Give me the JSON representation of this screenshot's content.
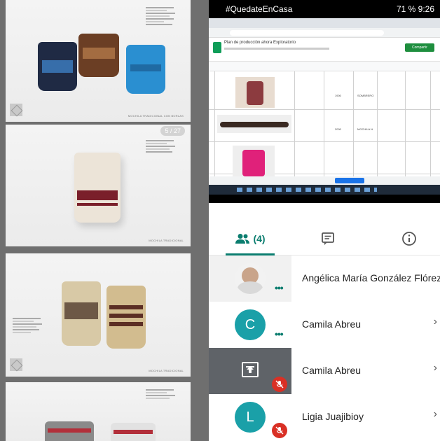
{
  "slides": {
    "pager": "5 / 27",
    "captions": [
      "MOCHILA TRADICIONAL CON BORLAS",
      "MOCHILA TRADICIONAL",
      "MOCHILA TRADICIONAL"
    ]
  },
  "status_bar": {
    "left": "#QuedateEnCasa",
    "right": "71 % 9:26"
  },
  "shared_screen": {
    "doc_title": "Plan de producción ahora Exploratorio",
    "share_label": "Compartir",
    "cell_values": [
      "1900",
      "SOMBRERO",
      "2000",
      "MOCHILA N"
    ]
  },
  "call_tabs": {
    "people_label": "(4)"
  },
  "participants": [
    {
      "name": "Angélica María González Flórez...",
      "avatar_letter": ""
    },
    {
      "name": "Camila Abreu",
      "avatar_letter": "C"
    },
    {
      "name": "Camila Abreu",
      "avatar_letter": ""
    },
    {
      "name": "Ligia Juajibioy",
      "avatar_letter": "L"
    }
  ],
  "colors": {
    "accent": "#0b7d6f",
    "avatar_teal": "#1aa0a8",
    "mute_red": "#d93025"
  }
}
